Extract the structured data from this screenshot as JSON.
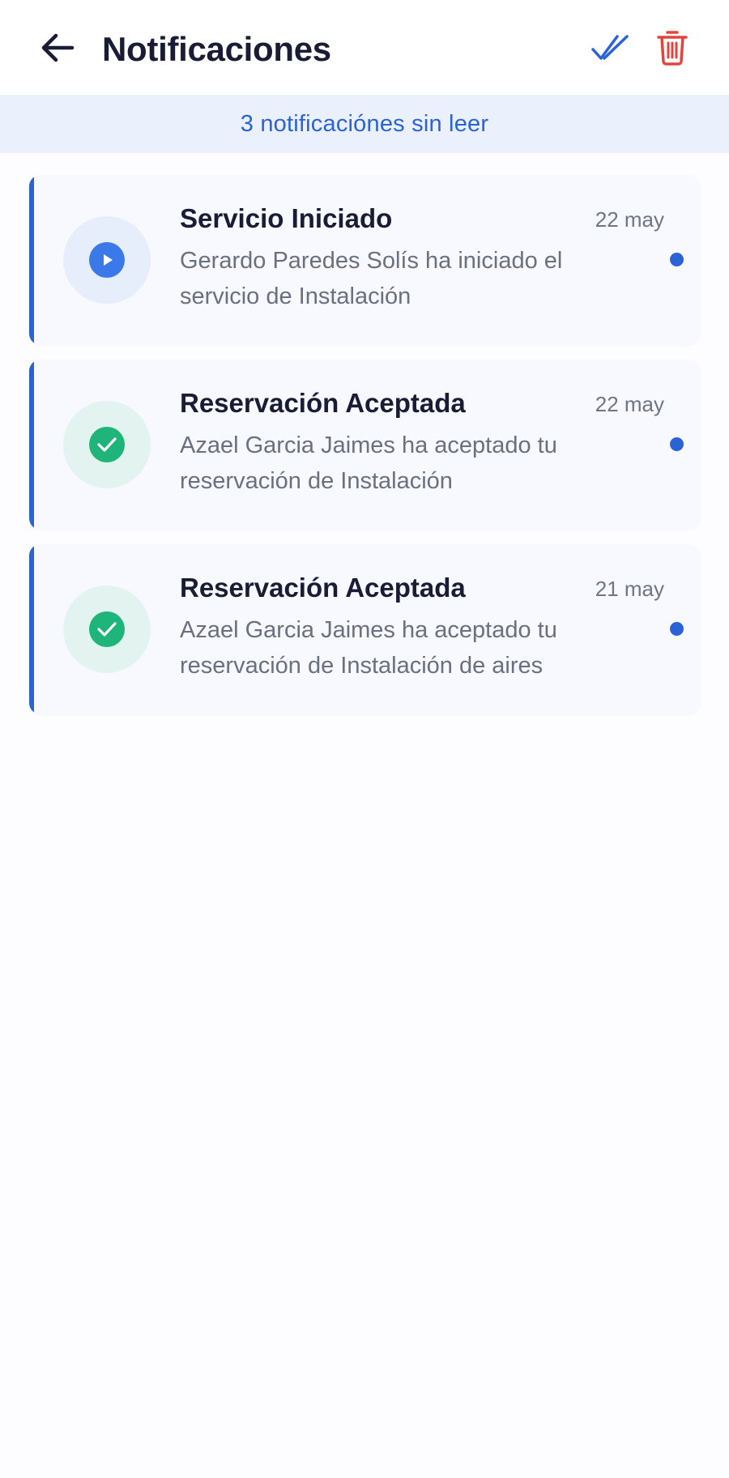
{
  "header": {
    "title": "Notificaciones",
    "back_icon": "arrow-left-icon",
    "mark_all_read_icon": "double-check-icon",
    "delete_icon": "trash-icon"
  },
  "banner": {
    "text": "3 notificaciónes sin leer"
  },
  "colors": {
    "accent": "#2b63d6",
    "title": "#1a1c35",
    "body": "#6b6f80",
    "delete": "#e0463f",
    "success": "#1fb57a",
    "info": "#3b79e8"
  },
  "notifications": [
    {
      "title": "Servicio Iniciado",
      "date": "22 may",
      "body": "Gerardo Paredes Solís ha iniciado el servicio de Instalación",
      "icon": "play-icon",
      "unread": true
    },
    {
      "title": "Reservación Aceptada",
      "date": "22 may",
      "body": "Azael Garcia Jaimes ha aceptado tu reservación de Instalación",
      "icon": "check-circle-icon",
      "unread": true
    },
    {
      "title": "Reservación Aceptada",
      "date": "21 may",
      "body": "Azael Garcia Jaimes ha aceptado tu reservación de Instalación de aires",
      "icon": "check-circle-icon",
      "unread": true
    }
  ]
}
